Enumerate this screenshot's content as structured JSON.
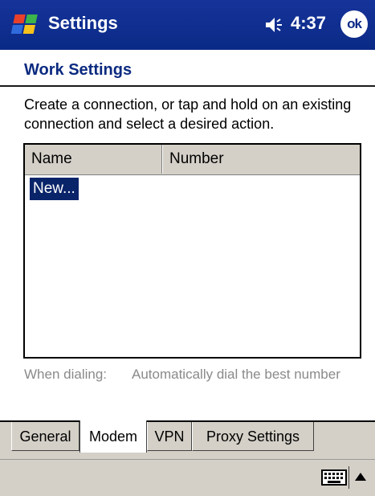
{
  "titlebar": {
    "app_title": "Settings",
    "time": "4:37",
    "ok_label": "ok",
    "icons": [
      "windows-start-icon",
      "volume-icon"
    ]
  },
  "page": {
    "title": "Work Settings",
    "instructions": "Create a connection, or tap and hold on an existing connection and select a desired action."
  },
  "list": {
    "columns": [
      "Name",
      "Number"
    ],
    "items": [
      {
        "name": "New...",
        "selected": true
      }
    ]
  },
  "dialing": {
    "label": "When dialing:",
    "value": "Automatically dial the best number"
  },
  "tabs": [
    {
      "label": "General",
      "active": false
    },
    {
      "label": "Modem",
      "active": true
    },
    {
      "label": "VPN",
      "active": false
    },
    {
      "label": "Proxy Settings",
      "active": false
    }
  ],
  "menubar": {
    "icons": [
      "keyboard-icon",
      "sip-arrow-up-icon"
    ]
  },
  "colors": {
    "titlebar": "#0a2a86",
    "selection": "#0a246a",
    "header_text": "#0b2a80",
    "chrome": "#d4d0c8"
  }
}
